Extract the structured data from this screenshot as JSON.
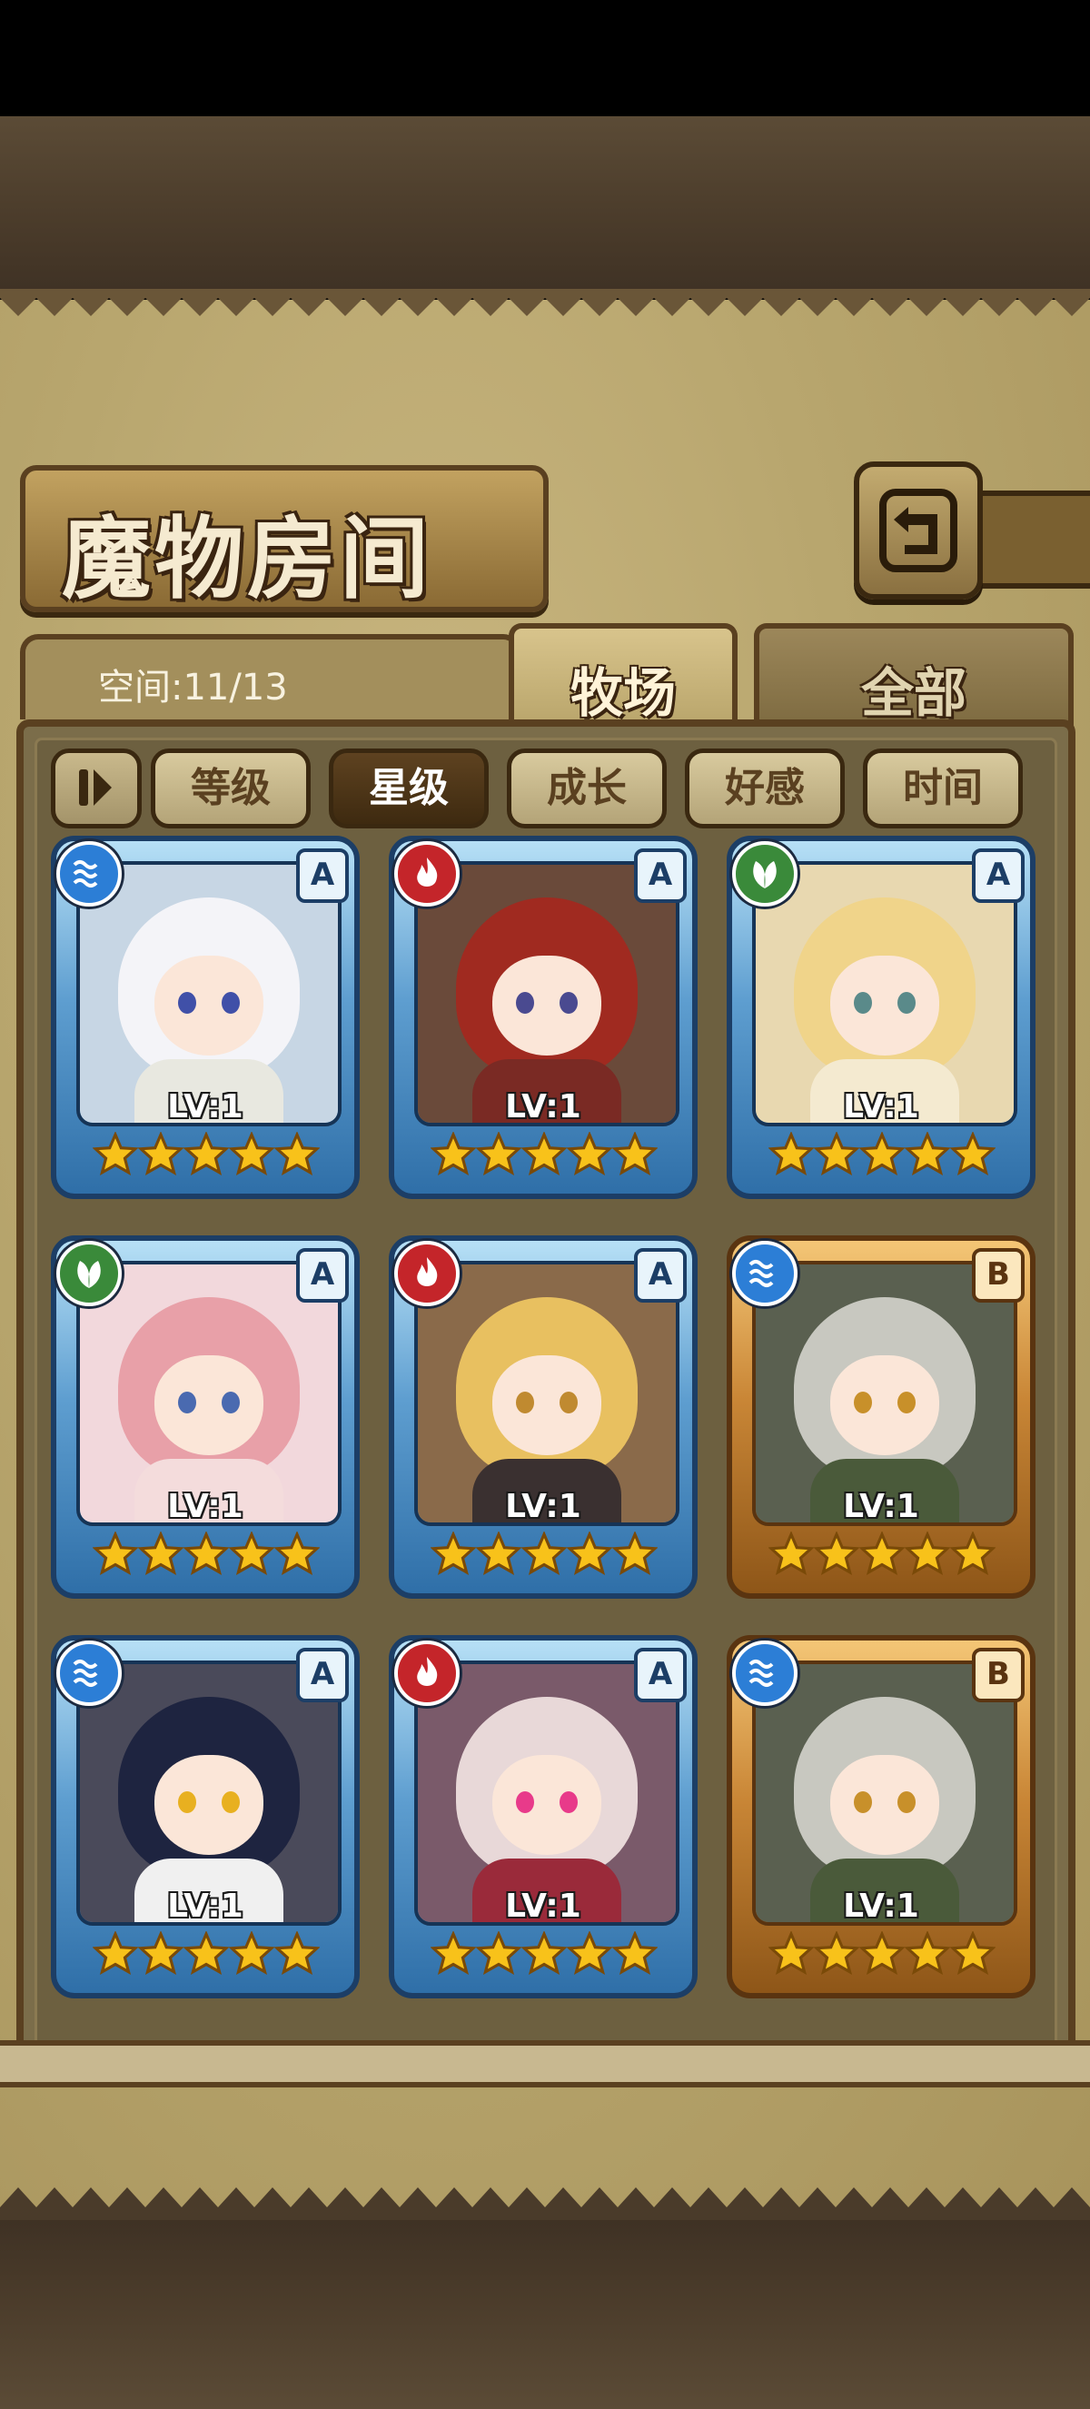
{
  "title": "魔物房间",
  "space": "空间:11/13",
  "tabs": [
    "牧场",
    "全部"
  ],
  "sort_buttons": [
    "等级",
    "星级",
    "成长",
    "好感",
    "时间"
  ],
  "active_sort": "星级",
  "icons": {
    "back": "return-arrow-icon",
    "sort_toggle": "sort-order-icon",
    "elements": [
      "water-element-icon",
      "fire-element-icon",
      "nature-element-icon"
    ],
    "star": "star-icon"
  },
  "colors": {
    "frame_a": "#2f6fa8",
    "frame_b": "#c98636",
    "water": "#2c7ed6",
    "fire": "#c4252a",
    "nature": "#3a8a3a",
    "star": "#f8c21a"
  },
  "monsters": [
    {
      "element": "water",
      "rank": "A",
      "level": "LV:1",
      "stars": 5
    },
    {
      "element": "fire",
      "rank": "A",
      "level": "LV:1",
      "stars": 5
    },
    {
      "element": "nature",
      "rank": "A",
      "level": "LV:1",
      "stars": 5
    },
    {
      "element": "nature",
      "rank": "A",
      "level": "LV:1",
      "stars": 5
    },
    {
      "element": "fire",
      "rank": "A",
      "level": "LV:1",
      "stars": 5
    },
    {
      "element": "water",
      "rank": "B",
      "level": "LV:1",
      "stars": 5
    },
    {
      "element": "water",
      "rank": "A",
      "level": "LV:1",
      "stars": 5
    },
    {
      "element": "fire",
      "rank": "A",
      "level": "LV:1",
      "stars": 5
    },
    {
      "element": "water",
      "rank": "B",
      "level": "LV:1",
      "stars": 5
    }
  ]
}
